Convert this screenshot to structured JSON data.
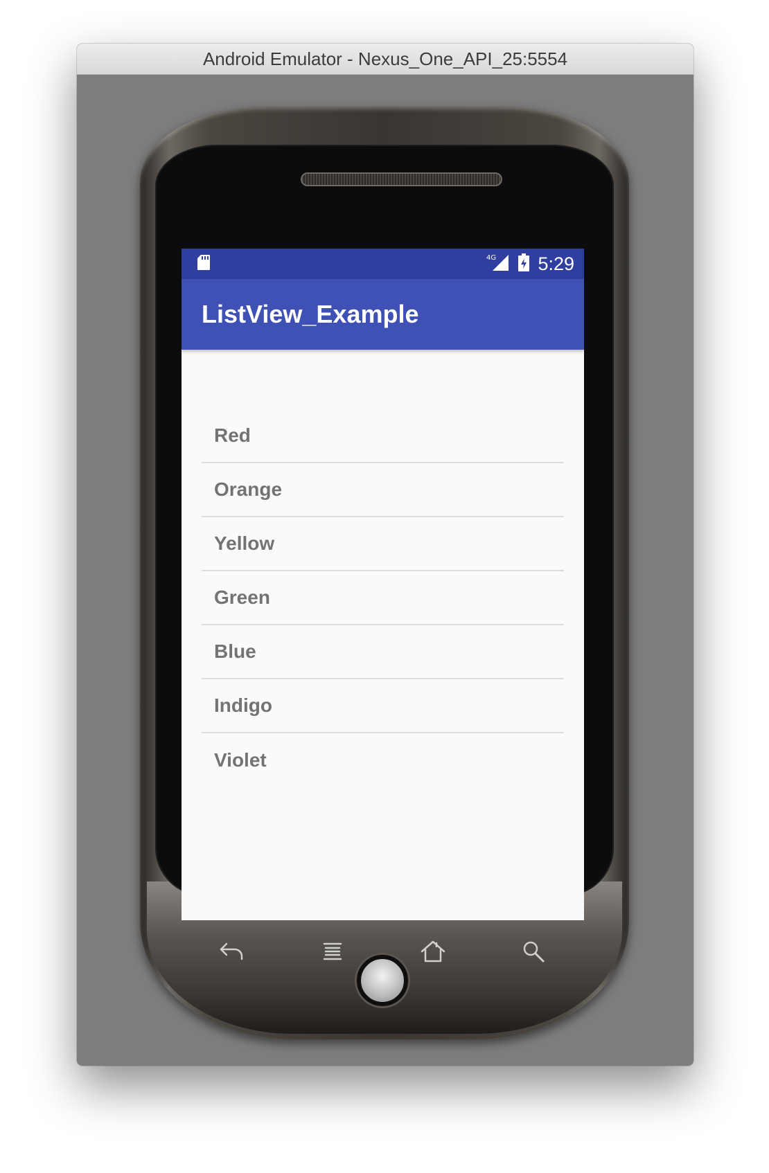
{
  "window": {
    "title": "Android Emulator - Nexus_One_API_25:5554"
  },
  "status_bar": {
    "time": "5:29",
    "network": "4G",
    "icons": [
      "sd-card-icon",
      "signal-icon",
      "battery-charging-icon"
    ]
  },
  "app_bar": {
    "title": "ListView_Example",
    "color": "#3f51b5",
    "status_color": "#303f9f"
  },
  "list": {
    "items": [
      "Red",
      "Orange",
      "Yellow",
      "Green",
      "Blue",
      "Indigo",
      "Violet"
    ]
  },
  "nav_bar": {
    "buttons": [
      "back-icon",
      "menu-icon",
      "home-icon",
      "search-icon"
    ]
  }
}
